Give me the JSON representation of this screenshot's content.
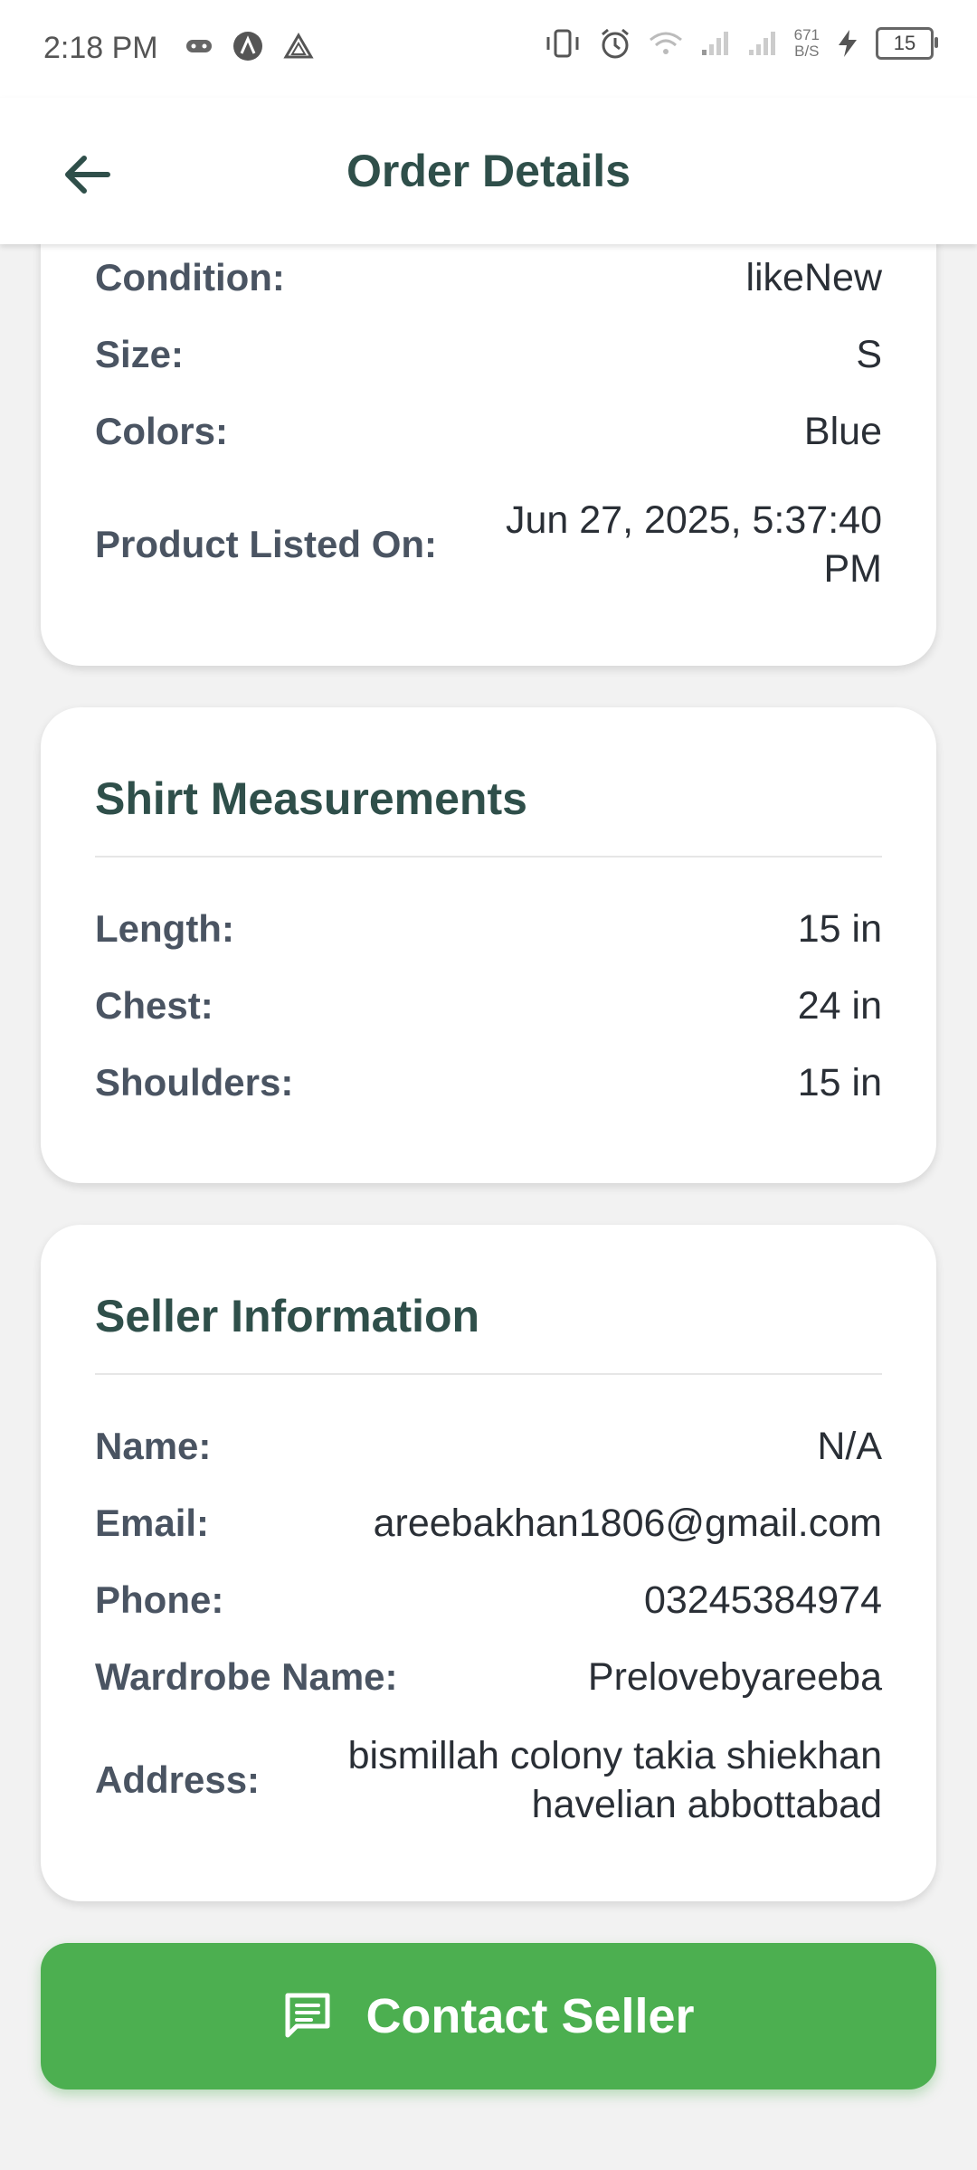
{
  "status_bar": {
    "time": "2:18 PM",
    "net_speed_value": "671",
    "net_speed_unit": "B/S",
    "battery": "15",
    "icons": [
      "gamepad-icon",
      "a-circle-icon",
      "drive-icon",
      "vibrate-icon",
      "alarm-icon",
      "wifi-icon",
      "signal-icon",
      "signal-icon",
      "charging-icon",
      "battery-icon"
    ]
  },
  "header": {
    "title": "Order Details",
    "back_icon": "arrow-left-icon"
  },
  "product_card": {
    "rows": [
      {
        "label": "Condition:",
        "value": "likeNew"
      },
      {
        "label": "Size:",
        "value": "S"
      },
      {
        "label": "Colors:",
        "value": "Blue"
      },
      {
        "label": "Product Listed On:",
        "value_line1": "Jun 27, 2025, 5:37:40",
        "value_line2": "PM"
      }
    ]
  },
  "measurements_card": {
    "title": "Shirt Measurements",
    "rows": [
      {
        "label": "Length:",
        "value": "15 in"
      },
      {
        "label": "Chest:",
        "value": "24 in"
      },
      {
        "label": "Shoulders:",
        "value": "15 in"
      }
    ]
  },
  "seller_card": {
    "title": "Seller Information",
    "rows": [
      {
        "label": "Name:",
        "value": "N/A"
      },
      {
        "label": "Email:",
        "value": "areebakhan1806@gmail.com"
      },
      {
        "label": "Phone:",
        "value": "03245384974"
      },
      {
        "label": "Wardrobe Name:",
        "value": "Prelovebyareeba"
      },
      {
        "label": "Address:",
        "value_line1": "bismillah colony takia shiekhan",
        "value_line2": "havelian abbottabad"
      }
    ]
  },
  "contact_button": {
    "label": "Contact Seller",
    "icon": "message-icon",
    "color": "#4caf50"
  },
  "colors": {
    "title": "#2f4f4a",
    "label": "#4a5462",
    "background": "#f2f2f2"
  }
}
